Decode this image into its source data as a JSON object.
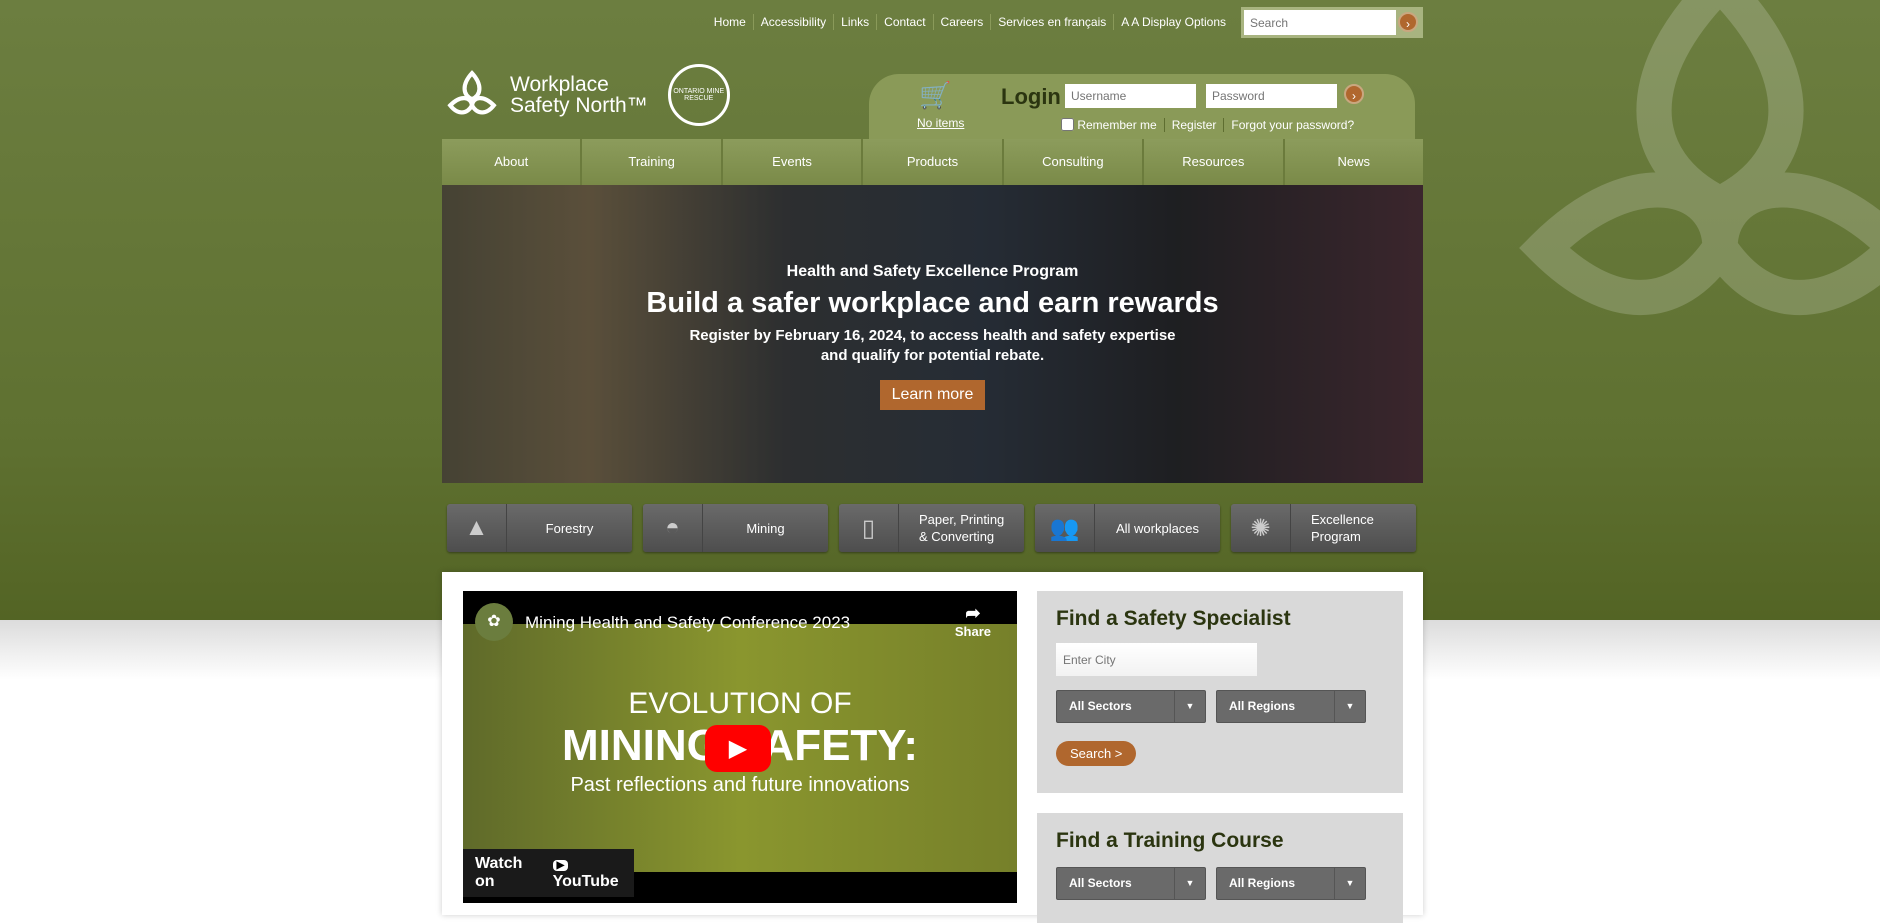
{
  "top_links": [
    "Home",
    "Accessibility",
    "Links",
    "Contact",
    "Careers",
    "Services en français",
    "A A Display Options"
  ],
  "top_search": {
    "placeholder": "Search",
    "go": "›"
  },
  "logo": {
    "line1": "Workplace",
    "line2": "Safety North™",
    "seal": "ONTARIO MINE RESCUE"
  },
  "login": {
    "title": "Login",
    "username_placeholder": "Username",
    "password_placeholder": "Password",
    "go": "›",
    "remember": "Remember me",
    "register": "Register",
    "forgot": "Forgot your password?",
    "cart": "No items"
  },
  "nav": [
    "About",
    "Training",
    "Events",
    "Products",
    "Consulting",
    "Resources",
    "News"
  ],
  "hero": {
    "subtitle": "Health and Safety Excellence Program",
    "title": "Build a safer workplace and earn rewards",
    "body1": "Register by February 16, 2024, to access health and safety expertise",
    "body2": "and qualify for potential rebate.",
    "button": "Learn more"
  },
  "sectors": [
    {
      "label": "Forestry",
      "icon": "tree-icon"
    },
    {
      "label": "Mining",
      "icon": "hardhat-icon"
    },
    {
      "label": "Paper, Printing & Converting",
      "icon": "paper-icon"
    },
    {
      "label": "All workplaces",
      "icon": "people-icon"
    },
    {
      "label": "Excellence Program",
      "icon": "badge-icon"
    }
  ],
  "video": {
    "title": "Mining Health and Safety Conference 2023",
    "share": "Share",
    "line1": "EVOLUTION OF",
    "line2": "MINING SAFETY:",
    "line3": "Past reflections and future innovations",
    "watch": "Watch on",
    "youtube": "YouTube"
  },
  "specialist": {
    "title": "Find a Safety Specialist",
    "city_placeholder": "Enter City",
    "sectors": "All Sectors",
    "regions": "All Regions",
    "search": "Search  >"
  },
  "training": {
    "title": "Find a Training Course",
    "sectors": "All Sectors",
    "regions": "All Regions"
  },
  "colors": {
    "brand_green": "#6c7e40",
    "accent_orange": "#b0672e"
  }
}
